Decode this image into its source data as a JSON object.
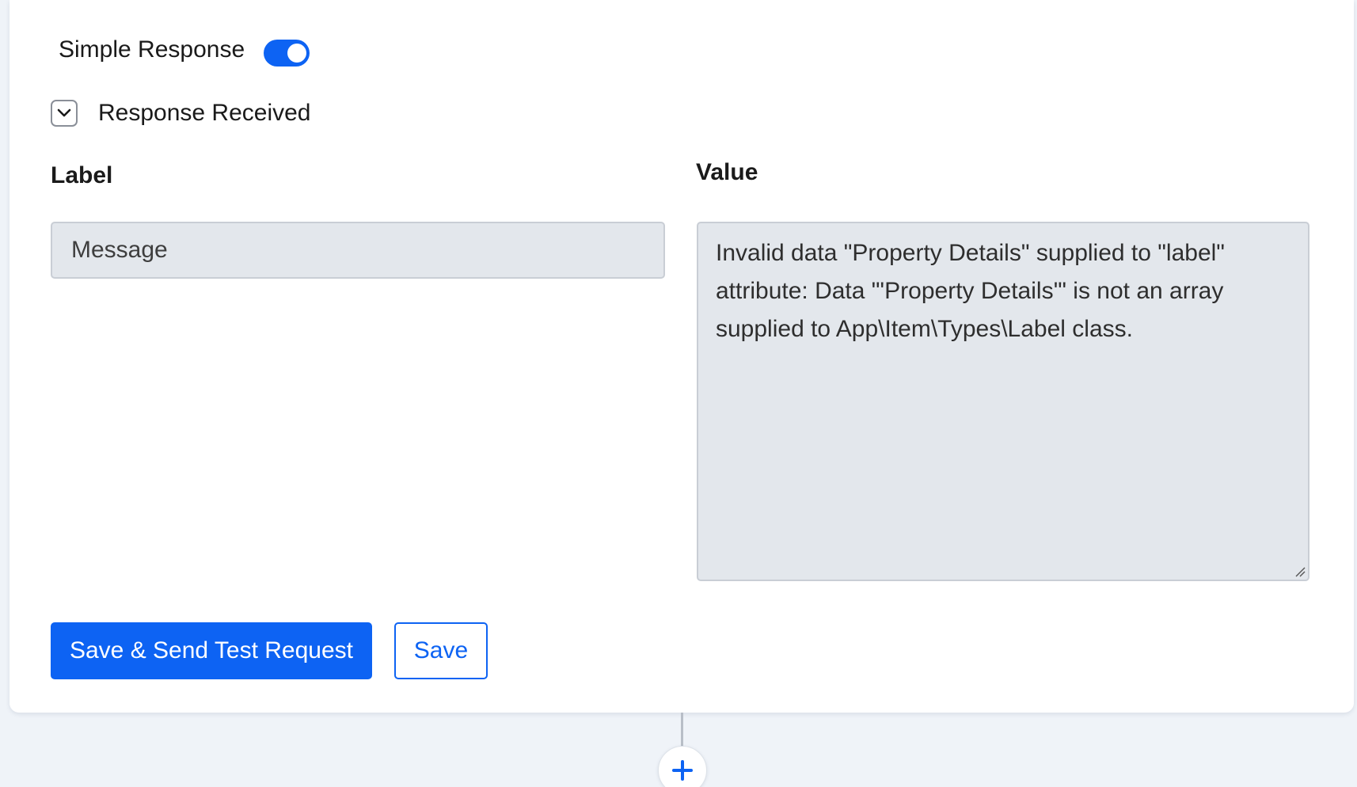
{
  "response_toggle": {
    "label": "Simple Response",
    "enabled": true
  },
  "response_section": {
    "title": "Response Received",
    "expanded": true,
    "chevron_icon": "chevron-down-icon"
  },
  "fields": {
    "label_heading": "Label",
    "value_heading": "Value",
    "label_value": "Message",
    "value_text": "Invalid data \"Property Details\" supplied to \"label\" attribute: Data \"'Property Details'\" is not an array supplied to App\\Item\\Types\\Label class."
  },
  "actions": {
    "save_and_send_label": "Save & Send Test Request",
    "save_label": "Save"
  },
  "flow": {
    "add_step_icon": "plus-icon"
  },
  "colors": {
    "accent": "#0d63f3",
    "field_background": "#e3e7ec",
    "page_background": "#eff3f8"
  }
}
